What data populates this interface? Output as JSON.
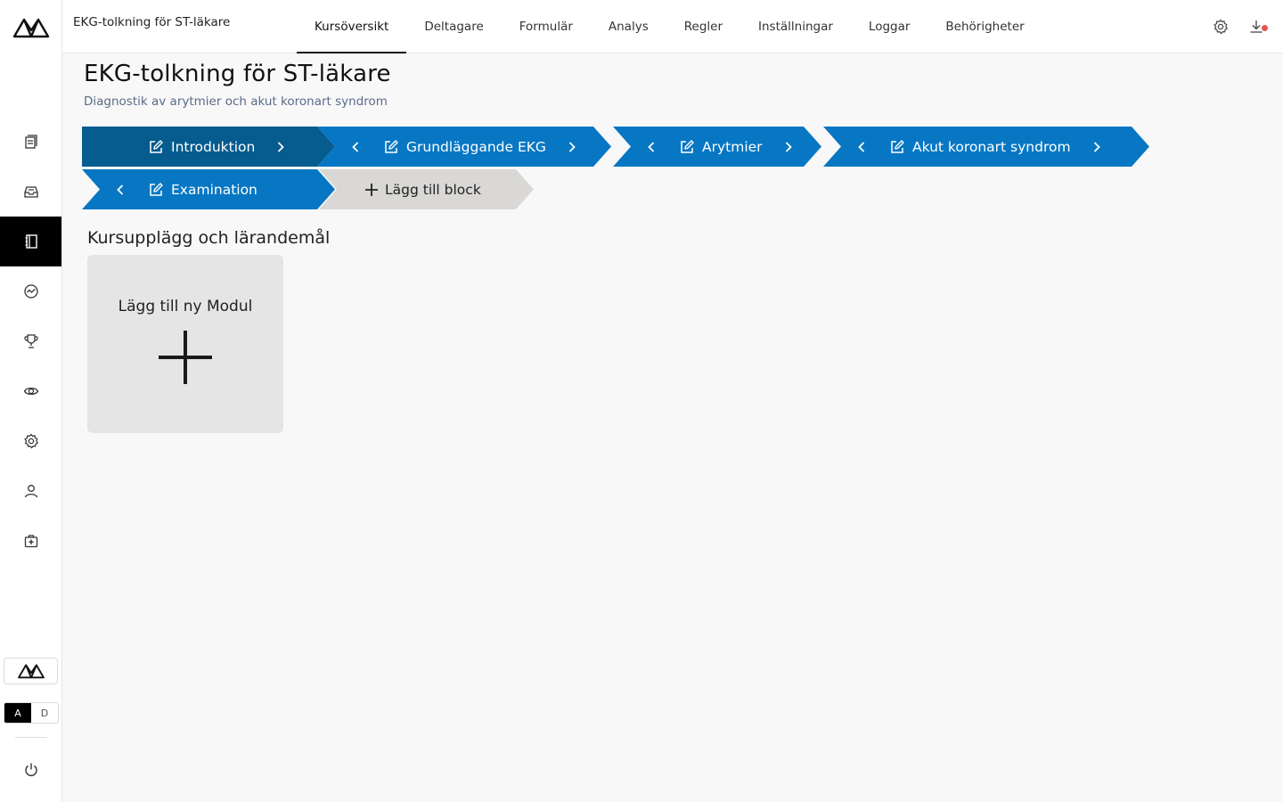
{
  "app": {
    "title": "EKG-tolkning för ST-läkare"
  },
  "tabs": [
    {
      "label": "Kursöversikt",
      "active": true
    },
    {
      "label": "Deltagare"
    },
    {
      "label": "Formulär"
    },
    {
      "label": "Analys"
    },
    {
      "label": "Regler"
    },
    {
      "label": "Inställningar"
    },
    {
      "label": "Loggar"
    },
    {
      "label": "Behörigheter"
    }
  ],
  "sidebar": {
    "items": [
      {
        "icon": "documents-icon"
      },
      {
        "icon": "inbox-icon"
      },
      {
        "icon": "notebook-icon",
        "active": true
      },
      {
        "icon": "analytics-icon"
      },
      {
        "icon": "trophy-icon"
      },
      {
        "icon": "eye-icon"
      },
      {
        "icon": "gear-icon"
      },
      {
        "icon": "user-icon"
      },
      {
        "icon": "medical-case-icon"
      }
    ],
    "lang_options": [
      "A",
      "D"
    ],
    "lang_selected": "A"
  },
  "page": {
    "title": "EKG-tolkning för ST-läkare",
    "subtitle": "Diagnostik av arytmier och akut koronart syndrom"
  },
  "blocks": [
    {
      "label": "Introduktion",
      "active": true
    },
    {
      "label": "Grundläggande EKG"
    },
    {
      "label": "Arytmier"
    },
    {
      "label": "Akut koronart syndrom"
    },
    {
      "label": "Examination"
    }
  ],
  "add_block_label": "Lägg till block",
  "section": {
    "title": "Kursupplägg och lärandemål"
  },
  "add_module_label": "Lägg till ny Modul",
  "colors": {
    "block_blue": "#0777c3",
    "block_active": "#065b8f",
    "add_block_bg": "#d9d8d6",
    "notification_dot": "#e5534b"
  }
}
